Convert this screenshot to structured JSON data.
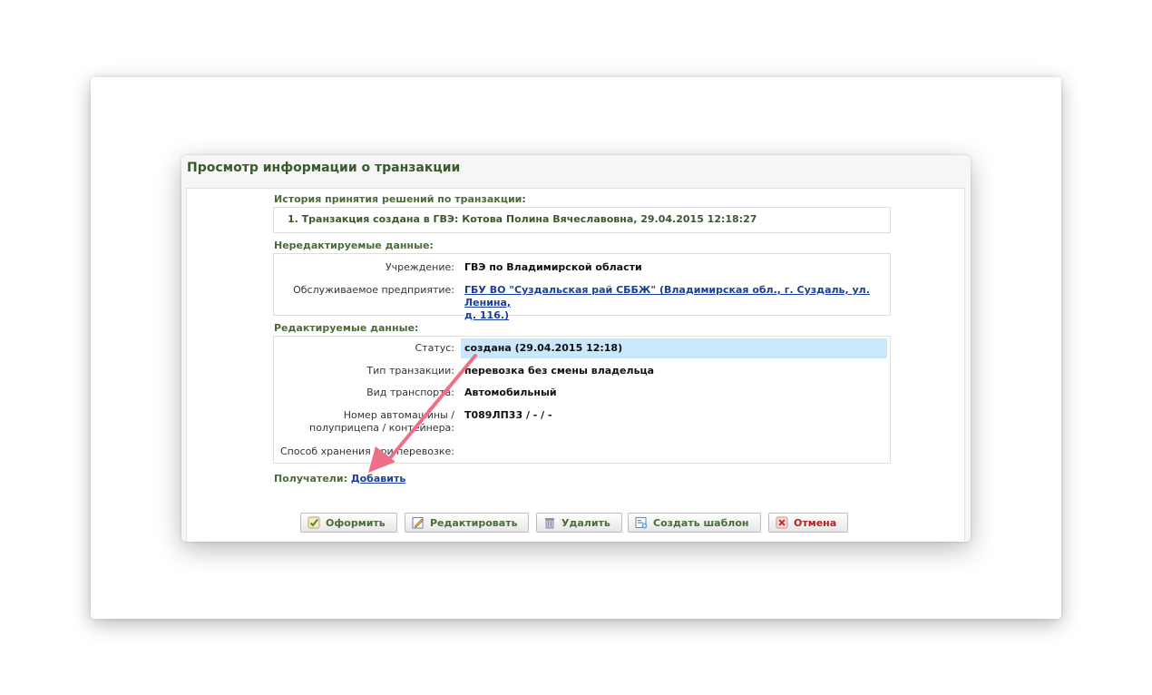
{
  "dialog": {
    "title": "Просмотр информации о транзакции"
  },
  "history": {
    "label": "История принятия решений по транзакции:",
    "entry": "1. Транзакция создана в ГВЭ: Котова Полина Вячеславовна, 29.04.2015 12:18:27"
  },
  "readonly": {
    "label": "Нередактируемые данные:",
    "institution_label": "Учреждение:",
    "institution_value": "ГВЭ по Владимирской области",
    "enterprise_label": "Обслуживаемое предприятие:",
    "enterprise_value_line1": "ГБУ ВО \"Суздальская рай СББЖ\" (Владимирская обл., г. Суздаль, ул. Ленина,",
    "enterprise_value_line2": "д. 116.)"
  },
  "editable": {
    "label": "Редактируемые данные:",
    "status_label": "Статус:",
    "status_value": "создана (29.04.2015 12:18)",
    "type_label": "Тип транзакции:",
    "type_value": "перевозка без смены владельца",
    "transport_label": "Вид транспорта:",
    "transport_value": "Автомобильный",
    "vehicle_label_line1": "Номер автомашины /",
    "vehicle_label_line2": "полуприцепа / контейнера:",
    "vehicle_value": "Т089ЛП33 / - / -",
    "storage_label": "Способ хранения при перевозке:"
  },
  "recipients": {
    "label": "Получатели:",
    "add_link": "Добавить"
  },
  "buttons": {
    "submit": "Оформить",
    "edit": "Редактировать",
    "delete": "Удалить",
    "template": "Создать шаблон",
    "cancel": "Отмена"
  },
  "colors": {
    "accent_green": "#4b6b3b",
    "link_blue": "#1a3f9c",
    "highlight": "#c9e8fb",
    "cancel_red": "#b22222",
    "arrow_pink": "#ef6f86"
  }
}
